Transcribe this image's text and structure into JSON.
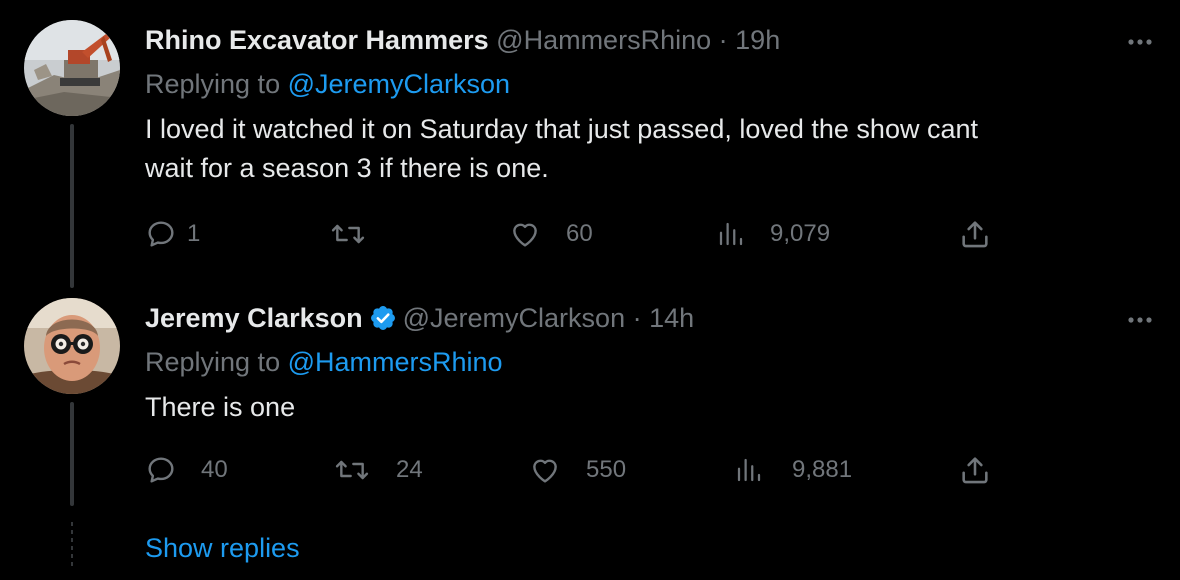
{
  "colors": {
    "background": "#000000",
    "text_primary": "#e7e9ea",
    "text_secondary": "#71767b",
    "accent": "#1d9bf0"
  },
  "tweets": [
    {
      "name": "Rhino Excavator Hammers",
      "handle": "@HammersRhino",
      "separator": "·",
      "time": "19h",
      "verified": false,
      "replying_prefix": "Replying to",
      "replying_to": "@JeremyClarkson",
      "text_line1": "I loved it watched it on Saturday that just passed, loved the show cant",
      "text_line2": "wait for a season 3 if there is one.",
      "replies": "1",
      "retweets": "",
      "likes": "60",
      "views": "9,079",
      "avatar_icon": "excavator-photo-avatar"
    },
    {
      "name": "Jeremy Clarkson",
      "handle": "@JeremyClarkson",
      "separator": "·",
      "time": "14h",
      "verified": true,
      "replying_prefix": "Replying to",
      "replying_to": "@HammersRhino",
      "text_line1": "There is one",
      "replies": "40",
      "retweets": "24",
      "likes": "550",
      "views": "9,881",
      "avatar_icon": "man-with-glasses-avatar"
    }
  ],
  "show_replies_label": "Show replies",
  "icons": {
    "more": "more-options-icon",
    "reply": "reply-bubble-icon",
    "retweet": "retweet-icon",
    "like": "heart-icon",
    "views": "views-bar-chart-icon",
    "share": "share-upload-icon",
    "verified": "verified-badge-icon"
  }
}
